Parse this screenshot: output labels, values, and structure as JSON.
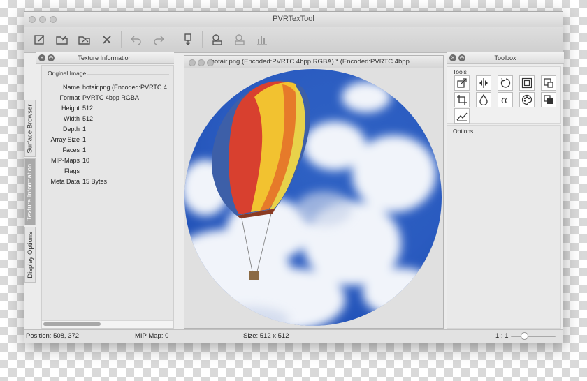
{
  "window": {
    "title": "PVRTexTool"
  },
  "toolbar": {
    "buttons": [
      "new-icon",
      "open-icon",
      "open-folder-icon",
      "close-icon",
      "undo-icon",
      "redo-icon",
      "encode-icon",
      "compress-icon",
      "compress-alt-icon",
      "histogram-icon"
    ]
  },
  "side_tabs": {
    "surface_browser": "Surface Browser",
    "texture_information": "Texture Information",
    "display_options": "Display Options"
  },
  "texture_info": {
    "title": "Texture Information",
    "group_label": "Original Image",
    "rows": [
      {
        "key": "Name",
        "value": "hotair.png (Encoded:PVRTC 4"
      },
      {
        "key": "Format",
        "value": "PVRTC 4bpp RGBA"
      },
      {
        "key": "Height",
        "value": "512"
      },
      {
        "key": "Width",
        "value": "512"
      },
      {
        "key": "Depth",
        "value": "1"
      },
      {
        "key": "Array Size",
        "value": "1"
      },
      {
        "key": "Faces",
        "value": "1"
      },
      {
        "key": "MIP-Maps",
        "value": "10"
      },
      {
        "key": "Flags",
        "value": ""
      },
      {
        "key": "Meta Data",
        "value": "15 Bytes"
      }
    ]
  },
  "document": {
    "title": "hotair.png (Encoded:PVRTC 4bpp RGBA) * (Encoded:PVRTC 4bpp ..."
  },
  "toolbox": {
    "title": "Toolbox",
    "tools_label": "Tools",
    "options_label": "Options",
    "tools": [
      "resize-icon",
      "flip-icon",
      "rotate-icon",
      "border-icon",
      "copy-channel-icon",
      "crop-icon",
      "water-drop-icon",
      "alpha-icon",
      "palette-icon",
      "layers-icon",
      "chart-icon"
    ]
  },
  "status": {
    "position": "Position: 508, 372",
    "mip_map": "MIP Map: 0",
    "size": "Size: 512 x 512",
    "zoom": "1 : 1"
  }
}
